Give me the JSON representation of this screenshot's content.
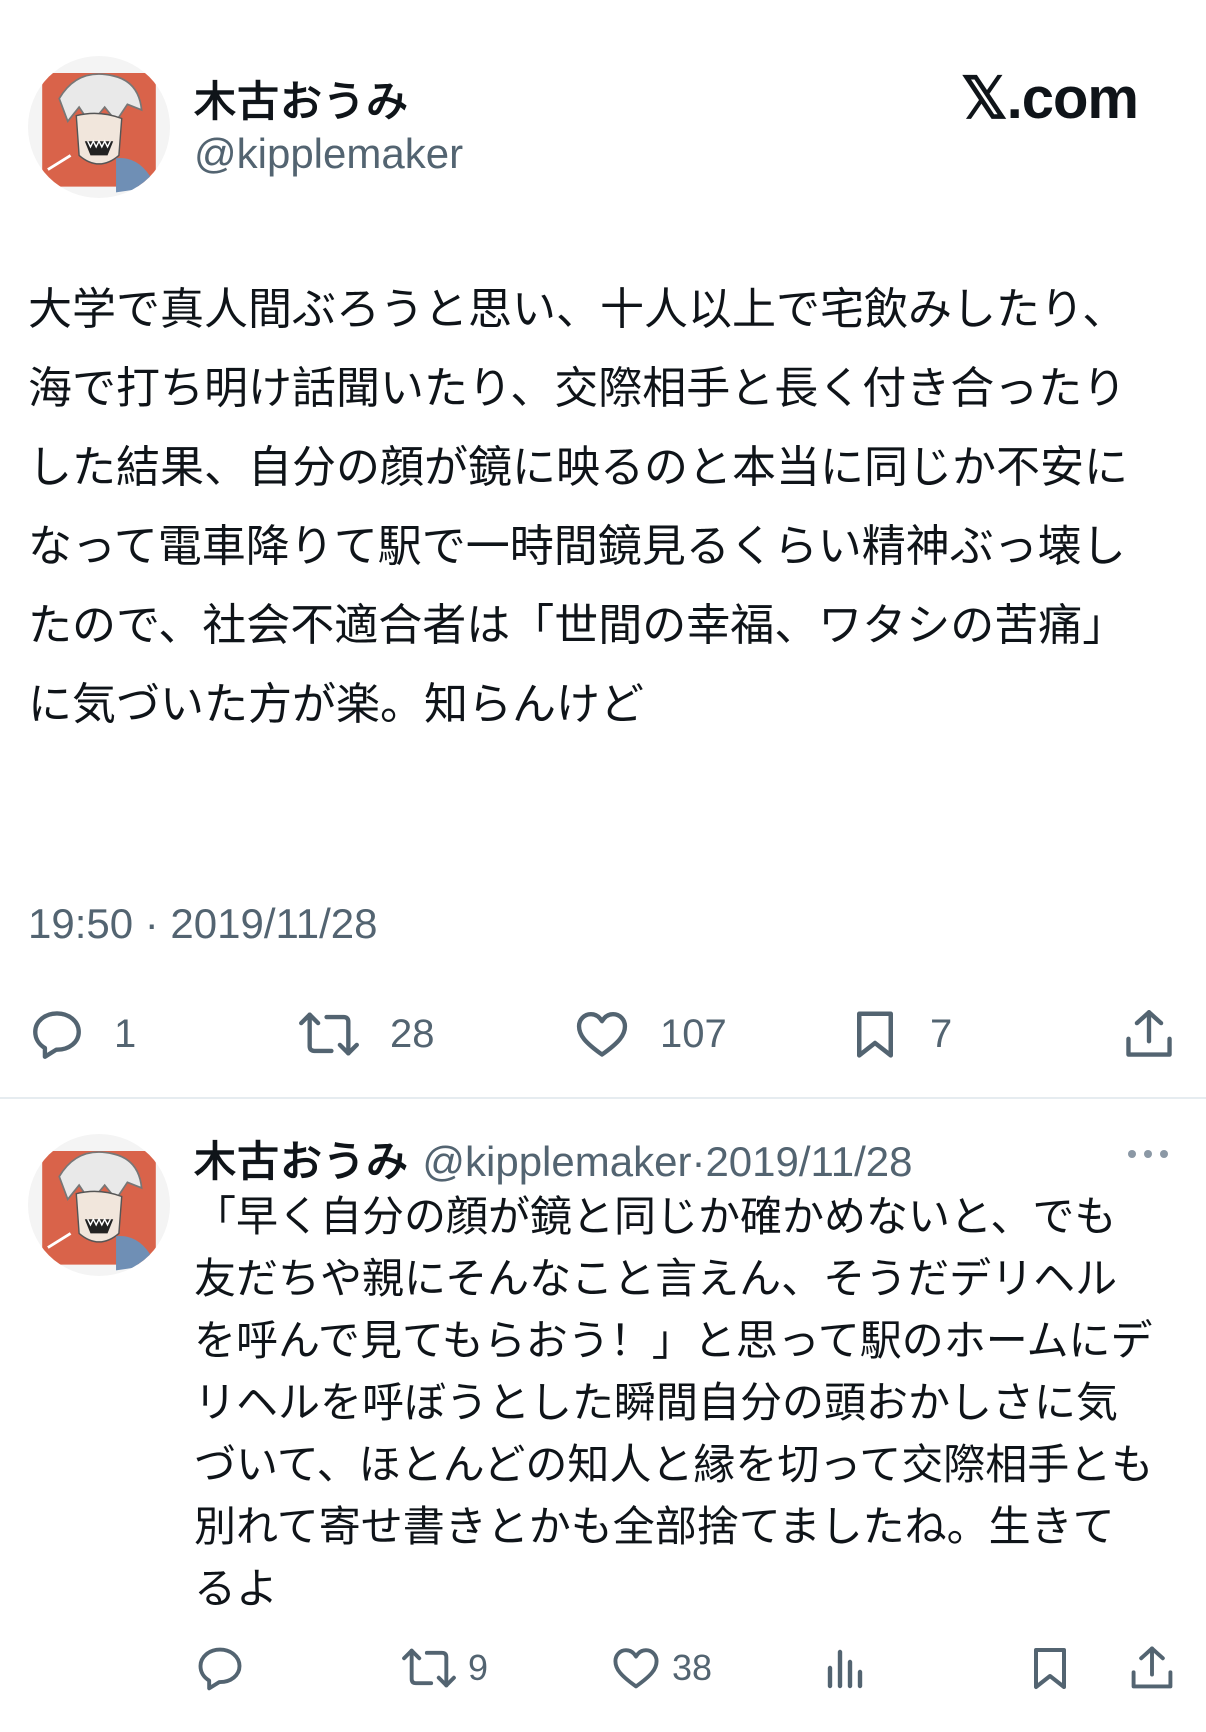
{
  "main_tweet": {
    "display_name": "木古おうみ",
    "handle": "@kipplemaker",
    "text": "大学で真人間ぶろうと思い、十人以上で宅飲みしたり、海で打ち明け話聞いたり、交際相手と長く付き合ったりした結果、自分の顔が鏡に映るのと本当に同じか不安になって電車降りて駅で一時間鏡見るくらい精神ぶっ壊したので、社会不適合者は「世間の幸福、ワタシの苦痛」に気づいた方が楽。知らんけど",
    "timestamp": "19:50 · 2019/11/28",
    "stats": {
      "replies": "1",
      "reposts": "28",
      "likes": "107",
      "bookmarks": "7"
    }
  },
  "brand": {
    "label": "𝕏.com"
  },
  "reply_tweet": {
    "display_name": "木古おうみ",
    "handle": "@kipplemaker",
    "separator": "·",
    "date": "2019/11/28",
    "text": "「早く自分の顔が鏡と同じか確かめないと、でも友だちや親にそんなこと言えん、そうだデリヘルを呼んで見てもらおう！」と思って駅のホームにデリヘルを呼ぼうとした瞬間自分の頭おかしさに気づいて、ほとんどの知人と縁を切って交際相手とも別れて寄せ書きとかも全部捨てましたね。生きてるよ",
    "stats": {
      "reposts": "9",
      "likes": "38"
    }
  },
  "icons": {
    "reply": "speech-bubble-icon",
    "repost": "repost-arrows-icon",
    "like": "heart-icon",
    "bookmark": "bookmark-icon",
    "share": "share-upload-icon",
    "views": "bar-chart-icon",
    "more": "more-dots-icon"
  },
  "colors": {
    "text": "#0f1419",
    "secondary": "#536471",
    "avatar_bg": "#d9634a"
  }
}
